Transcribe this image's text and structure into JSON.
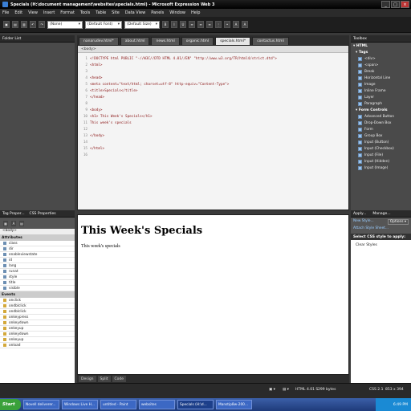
{
  "window": {
    "title": "Specials (H:\\document management\\websites\\specials.html) - Microsoft Expression Web 3",
    "min": "_",
    "max": "□",
    "close": "×"
  },
  "menu": [
    "File",
    "Edit",
    "View",
    "Insert",
    "Format",
    "Tools",
    "Table",
    "Site",
    "Data View",
    "Panels",
    "Window",
    "Help"
  ],
  "toolbar": {
    "style_select": "(None)",
    "font_select": "(Default Font)",
    "size_select": "(Default Size)"
  },
  "panels": {
    "folder_list": "Folder List",
    "tag_properties": "Tag Proper...",
    "css_properties": "CSS Properties",
    "toolbox": "Toolbox",
    "apply_styles": "Apply...",
    "manage_styles": "Manage..."
  },
  "tabs": [
    "nanarudev.html*",
    "about.html",
    "news.html",
    "organic.html",
    "specials.html*",
    "contactus.html"
  ],
  "code": {
    "breadcrumb": "<body>",
    "lines": [
      {
        "n": "1",
        "t": "<!DOCTYPE html PUBLIC \"-//W3C//DTD HTML 4.01//EN\" \"http://www.w3.org/TR/html4/strict.dtd\">"
      },
      {
        "n": "2",
        "t": "<html>"
      },
      {
        "n": "3",
        "t": ""
      },
      {
        "n": "4",
        "t": "<head>"
      },
      {
        "n": "5",
        "t": "<meta content=\"text/html; charset=utf-8\" http-equiv=\"Content-Type\">"
      },
      {
        "n": "6",
        "t": "<title>Specials</title>"
      },
      {
        "n": "7",
        "t": "</head>"
      },
      {
        "n": "8",
        "t": ""
      },
      {
        "n": "9",
        "t": "<body>"
      },
      {
        "n": "10",
        "t": "<h1> This Week's Specials</h1>"
      },
      {
        "n": "11",
        "t": "This week's specials"
      },
      {
        "n": "12",
        "t": ""
      },
      {
        "n": "13",
        "t": "</body>"
      },
      {
        "n": "14",
        "t": ""
      },
      {
        "n": "15",
        "t": "</html>"
      },
      {
        "n": "16",
        "t": ""
      }
    ]
  },
  "design": {
    "heading": "This Week's Specials",
    "body": "This week's specials"
  },
  "view_tabs": [
    "Design",
    "Split",
    "Code"
  ],
  "tag_props": {
    "crumb": "<body>",
    "attributes_head": "Attributes",
    "attributes": [
      "class",
      "dir",
      "enableviewstate",
      "id",
      "lang",
      "runat",
      "style",
      "title",
      "visible"
    ],
    "events_head": "Events",
    "events": [
      "onclick",
      "ondblclick",
      "ondblclick",
      "onkeypress",
      "onkeydown",
      "onkeyup",
      "onkeydown",
      "onkeyup",
      "onload"
    ]
  },
  "toolbox": {
    "html": "HTML",
    "tags": "Tags",
    "tag_items": [
      "<div>",
      "<span>",
      "Break",
      "Horizontal Line",
      "Image",
      "Inline Frame",
      "Layer",
      "Paragraph"
    ],
    "form_controls": "Form Controls",
    "form_items": [
      "Advanced Button",
      "Drop-Down Box",
      "Form",
      "Group Box",
      "Input (Button)",
      "Input (Checkbox)",
      "Input (File)",
      "Input (Hidden)",
      "Input (Image)"
    ]
  },
  "apply_styles": {
    "new_style": "New Style...",
    "options": "Options",
    "attach": "Attach Style Sheet...",
    "select_label": "Select CSS style to apply:",
    "clear": "Clear Styles"
  },
  "status": {
    "doctype": "HTML 4.01 S",
    "size": "299 bytes",
    "css": "CSS 2.1",
    "dims": "853 x 394"
  },
  "taskbar": {
    "start": "Start",
    "tasks": [
      "Novell deliverer...",
      "Windows Live H...",
      "untitled - Paint",
      "websites",
      "Specials (H:\\d...",
      "Manstip8w-200..."
    ],
    "clock": "6:49 PM"
  }
}
